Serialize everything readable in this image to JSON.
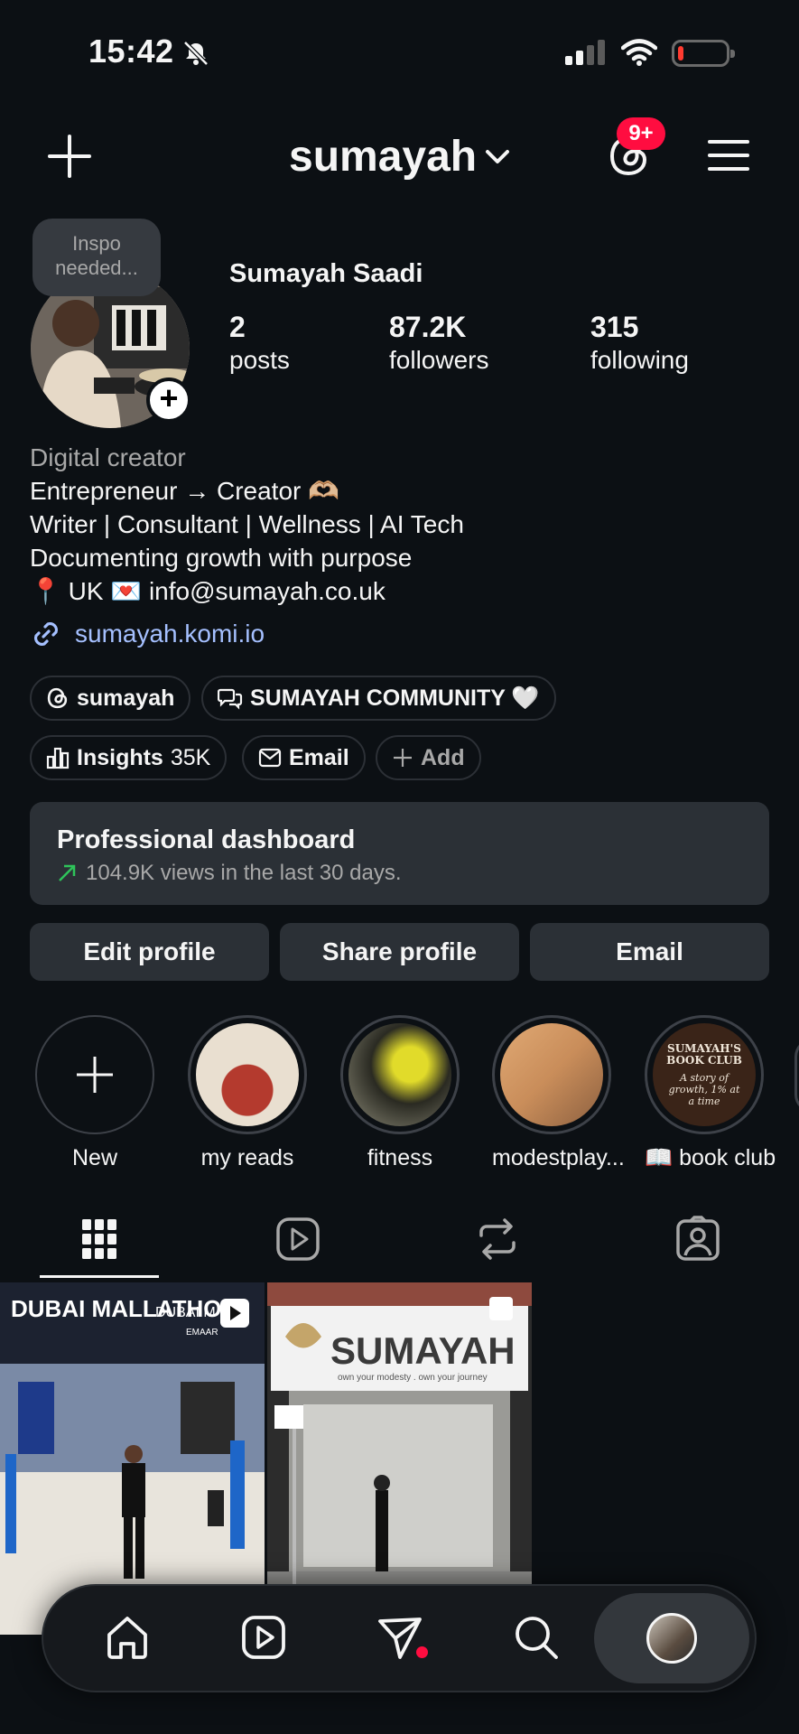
{
  "status_bar": {
    "time": "15:42"
  },
  "header": {
    "username": "sumayah",
    "notification_badge": "9+"
  },
  "profile": {
    "note": "Inspo needed...",
    "display_name": "Sumayah Saadi",
    "stats": [
      {
        "value": "2",
        "label": "posts"
      },
      {
        "value": "87.2K",
        "label": "followers"
      },
      {
        "value": "315",
        "label": "following"
      }
    ],
    "bio": {
      "category": "Digital creator",
      "lines": [
        "Entrepreneur → Creator 🫶🏼",
        "Writer | Consultant | Wellness | AI Tech",
        "Documenting growth with purpose",
        "📍 UK 💌 info@sumayah.co.uk"
      ],
      "link": "sumayah.komi.io"
    },
    "chips_row1": [
      {
        "label": "sumayah",
        "icon": "threads-icon"
      },
      {
        "label": "SUMAYAH COMMUNITY 🤍",
        "icon": "community-chat-icon"
      }
    ],
    "chips_row2": [
      {
        "label": "Insights",
        "extra": "35K",
        "icon": "bar-chart-icon"
      },
      {
        "label": "Email",
        "icon": "mail-icon"
      },
      {
        "label": "Add",
        "icon": "plus-icon"
      }
    ]
  },
  "dashboard": {
    "title": "Professional dashboard",
    "subtitle": "104.9K views in the last 30 days."
  },
  "actions": [
    "Edit profile",
    "Share profile",
    "Email"
  ],
  "highlights": [
    {
      "label": "New"
    },
    {
      "label": "my reads",
      "color": "#b43a2e"
    },
    {
      "label": "fitness",
      "color": "#c8c222"
    },
    {
      "label": "modestplay...",
      "color": "#c98d5a"
    },
    {
      "label": "📖 book club",
      "color": "#3a2418",
      "cover_title": "SUMAYAH'S BOOK CLUB",
      "cover_subtitle": "A story of growth, 1% at a time"
    }
  ],
  "tabs": [
    "grid-icon",
    "reels-icon",
    "reposts-icon",
    "tagged-icon"
  ],
  "posts": [
    {
      "caption_top": "DUBAI MALLATHON",
      "caption_right": "DUBAI M",
      "sponsor": "EMAAR",
      "type": "reel"
    },
    {
      "sign": "SUMAYAH",
      "tagline": "own your modesty . own your journey",
      "type": "carousel"
    }
  ],
  "nav": [
    "home-icon",
    "reels-icon",
    "direct-icon",
    "search-icon",
    "profile-avatar"
  ]
}
